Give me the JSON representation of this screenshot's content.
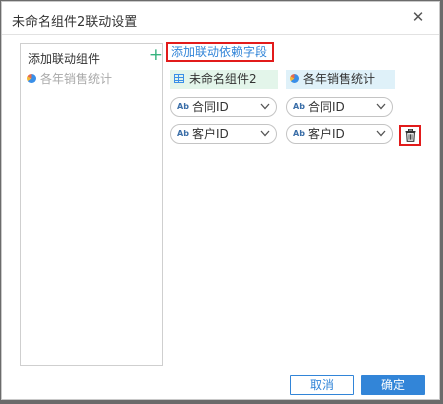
{
  "dialog": {
    "title": "未命名组件2联动设置",
    "close_icon": "✕"
  },
  "left_panel": {
    "title": "添加联动组件",
    "add_icon": "+",
    "items": [
      {
        "label": "各年销售统计",
        "icon": "pie-chart-icon"
      }
    ]
  },
  "main": {
    "add_field_link": "添加联动依赖字段",
    "columns": [
      {
        "label": "未命名组件2",
        "icon": "table-icon"
      },
      {
        "label": "各年销售统计",
        "icon": "pie-chart-icon"
      }
    ],
    "rows": [
      {
        "left": "合同ID",
        "right": "合同ID",
        "type_icon": "Ab"
      },
      {
        "left": "客户ID",
        "right": "客户ID",
        "type_icon": "Ab"
      }
    ]
  },
  "footer": {
    "cancel": "取消",
    "ok": "确定"
  },
  "colors": {
    "accent": "#3285d8",
    "highlight_red": "#e21b1b",
    "plus_green": "#36b37e",
    "header_green_bg": "#e3f5ea",
    "header_blue_bg": "#dff1f9"
  }
}
